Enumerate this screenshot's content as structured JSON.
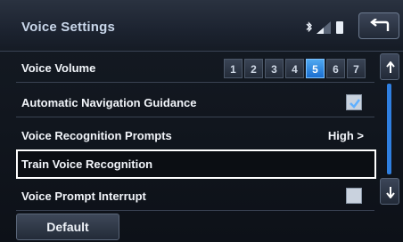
{
  "header": {
    "title": "Voice Settings",
    "status_icons": [
      "bluetooth-icon",
      "signal-icon",
      "battery-icon"
    ],
    "back_icon": "back-arrow-icon"
  },
  "list": {
    "voice_volume": {
      "label": "Voice Volume",
      "levels": [
        "1",
        "2",
        "3",
        "4",
        "5",
        "6",
        "7"
      ],
      "selected": "5"
    },
    "auto_nav_guidance": {
      "label": "Automatic Navigation Guidance",
      "checked": true
    },
    "recognition_prompts": {
      "label": "Voice Recognition Prompts",
      "value": "High >"
    },
    "train_recognition": {
      "label": "Train Voice Recognition",
      "selected": true
    },
    "prompt_interrupt": {
      "label": "Voice Prompt Interrupt",
      "checked": false
    }
  },
  "footer": {
    "default_label": "Default"
  },
  "colors": {
    "accent": "#2f7fe0",
    "active_button": "#3b93ea",
    "title_text": "#c9d7ea"
  }
}
